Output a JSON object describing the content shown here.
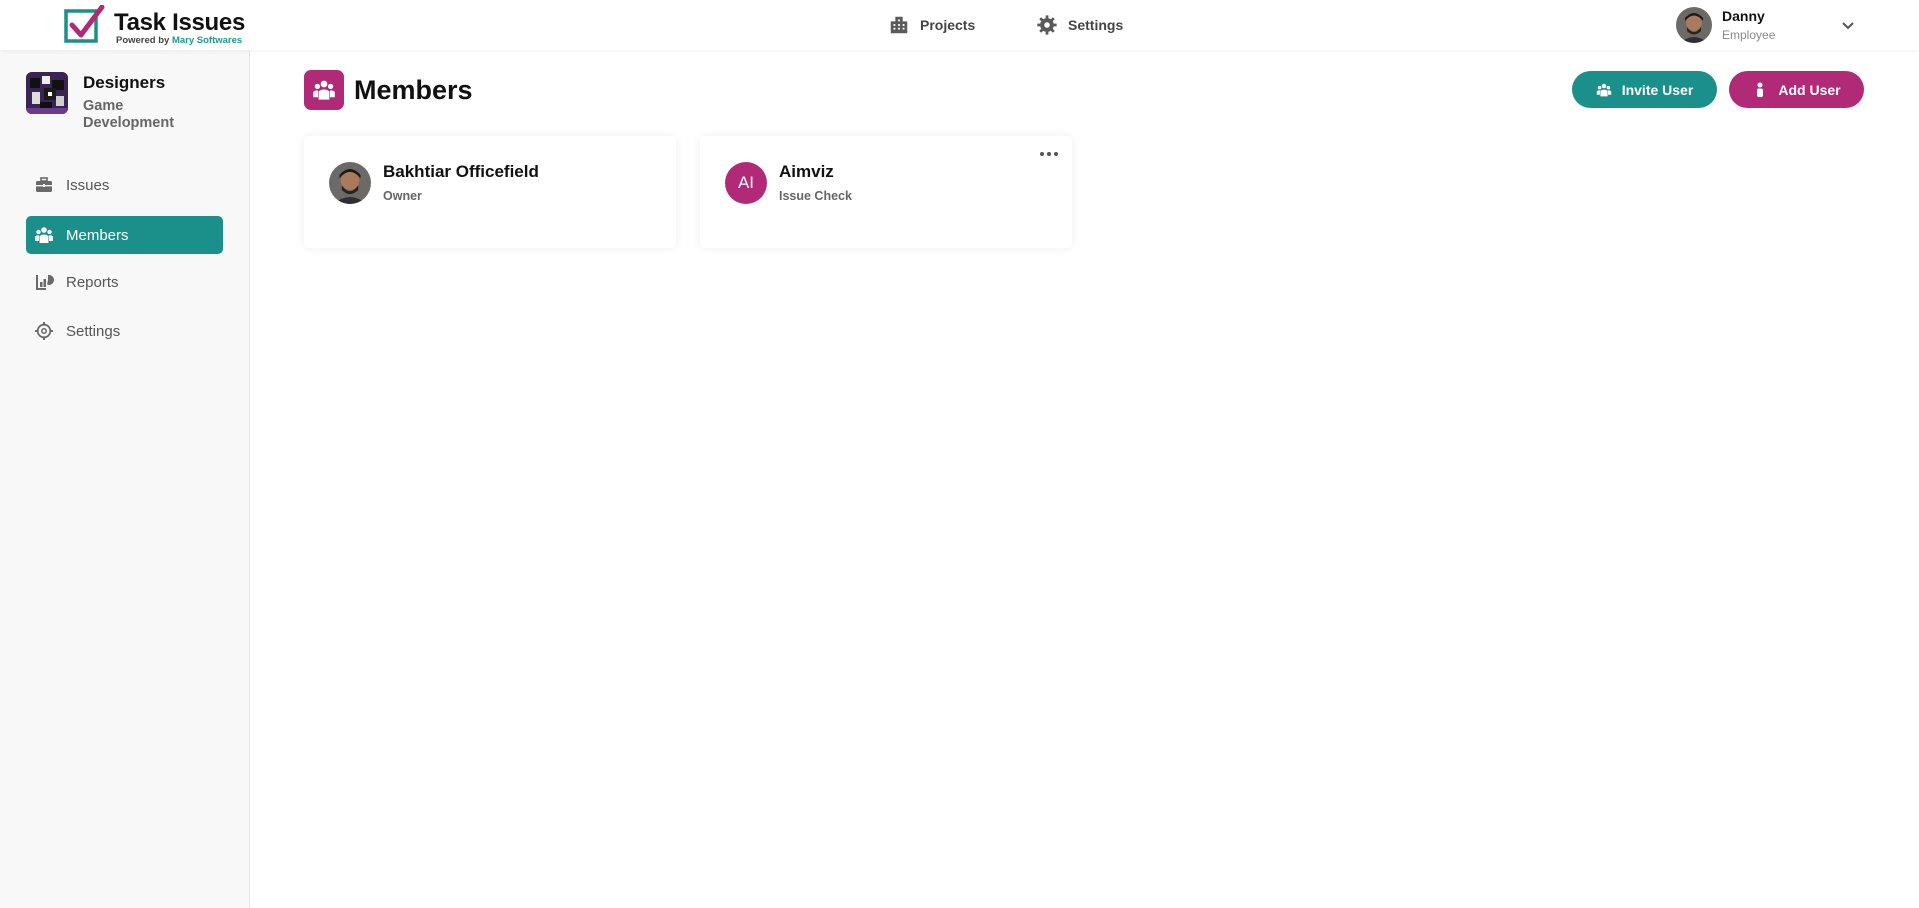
{
  "header": {
    "logo_title": "Task Issues",
    "logo_sub_prefix": "Powered by",
    "logo_sub_brand": "Mary Softwares",
    "nav": [
      {
        "label": "Projects",
        "icon": "building-icon"
      },
      {
        "label": "Settings",
        "icon": "gear-icon"
      }
    ],
    "user": {
      "name": "Danny",
      "role": "Employee"
    }
  },
  "sidebar": {
    "team_name": "Designers",
    "team_desc": "Game Development",
    "items": [
      {
        "label": "Issues",
        "icon": "briefcase-icon",
        "active": false
      },
      {
        "label": "Members",
        "icon": "people-icon",
        "active": true
      },
      {
        "label": "Reports",
        "icon": "report-icon",
        "active": false
      },
      {
        "label": "Settings",
        "icon": "gear-icon",
        "active": false
      }
    ]
  },
  "main": {
    "title": "Members",
    "invite_label": "Invite User",
    "add_label": "Add User",
    "members": [
      {
        "name": "Bakhtiar Officefield",
        "role": "Owner"
      },
      {
        "name": "Aimviz",
        "role": "Issue Check",
        "initials": "AI"
      }
    ]
  },
  "colors": {
    "teal": "#1b8f89",
    "magenta": "#b02a78"
  }
}
